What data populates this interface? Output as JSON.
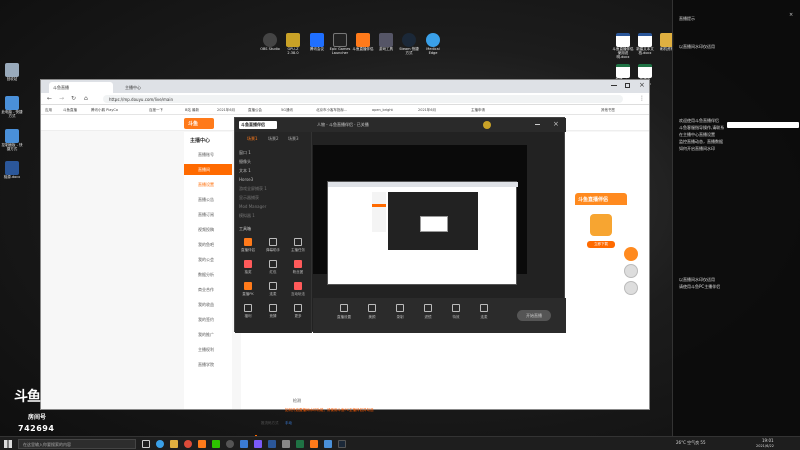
{
  "desktop": {
    "left_icons": [
      {
        "label": "回收站",
        "color": "#9ab"
      },
      {
        "label": "此电脑 - 快捷方式",
        "color": "#4a90d9"
      },
      {
        "label": "控制面板 - 快捷方式",
        "color": "#4a90d9"
      },
      {
        "label": "桃源.docx",
        "color": "#2b579a"
      }
    ],
    "top_icons": [
      {
        "label": "OBS Studio",
        "color": "#444"
      },
      {
        "label": "GPU-Z 2.38.0",
        "color": "#c9a227"
      },
      {
        "label": "腾讯会议",
        "color": "#1f6fff"
      },
      {
        "label": "Epic Games Launcher",
        "color": "#222"
      },
      {
        "label": "斗鱼直播伴侣",
        "color": "#ff7a1a"
      },
      {
        "label": "游戏工具",
        "color": "#556"
      },
      {
        "label": "Steam 快捷方式",
        "color": "#1b2838"
      },
      {
        "label": "Medical Edge",
        "color": "#3aa0e8"
      }
    ],
    "right_icons": [
      {
        "label": "斗鱼直播伴侣使用说明.docx",
        "color": "#2b579a"
      },
      {
        "label": "新建文本文档.docx",
        "color": "#2b579a"
      },
      {
        "label": "刷机资料",
        "color": "#e0b040"
      },
      {
        "label": "新建.xlsx",
        "color": "#1f7244"
      },
      {
        "label": "新建文本.xlsx",
        "color": "#1f7244"
      }
    ]
  },
  "browser": {
    "tabs": [
      "斗鱼直播",
      "主播中心"
    ],
    "url": "https://mp.douyu.com/live/main",
    "bookmarks": [
      "应用",
      "斗鱼直播",
      "腾讯小鹅 PlayCo",
      "百度一下",
      "B站 最新",
      "2021年6月",
      "直播公会",
      "5G通讯",
      "北京市小客车指标...",
      "open_bright",
      "2021年6月",
      "主播申请",
      "其他书签"
    ],
    "logo": "斗鱼",
    "sidebar": [
      {
        "label": "主播中心",
        "type": "head"
      },
      {
        "label": "直播账号",
        "type": "item"
      },
      {
        "label": "直播间",
        "type": "active"
      },
      {
        "label": "直播设置",
        "type": "sub"
      },
      {
        "label": "直播公告",
        "type": "item"
      },
      {
        "label": "直播订阅",
        "type": "item"
      },
      {
        "label": "视频投稿",
        "type": "item"
      },
      {
        "label": "我的鱼吧",
        "type": "item"
      },
      {
        "label": "我的公会",
        "type": "item"
      },
      {
        "label": "数据分析",
        "type": "item"
      },
      {
        "label": "商业合作",
        "type": "item"
      },
      {
        "label": "我的收益",
        "type": "item"
      },
      {
        "label": "我的签约",
        "type": "item"
      },
      {
        "label": "我的推广",
        "type": "item"
      },
      {
        "label": "主播权利",
        "type": "item"
      },
      {
        "label": "直播学院",
        "type": "item"
      }
    ],
    "content_lines": [
      "检测",
      "如何开启直播间水印功能，请使用斗鱼PC主播伴侣并勾选",
      "推流码方式",
      "手动"
    ],
    "section_other": "其他"
  },
  "app": {
    "title": "斗鱼直播伴侣",
    "room": "人物 - 斗鱼直播伴侣 · 已关播",
    "tabs": [
      "场景1",
      "场景2",
      "场景3"
    ],
    "sources": [
      "窗口 1",
      "摄像头",
      "文本 1",
      "Horse3",
      "游戏全屏捕获 1",
      "显示器捕获",
      "Mod Manager",
      "模拟器 1"
    ],
    "tools_label": "工具箱",
    "tools": [
      "直播伴侣",
      "弹幕助手",
      "主播任务",
      "抽奖",
      "红包",
      "粉丝团",
      "直播PK",
      "连麦",
      "互动玩法",
      "福利",
      "竞猜",
      "更多"
    ],
    "bottom": [
      "直播设置",
      "美颜",
      "录制",
      "滤镜",
      "特效",
      "连麦"
    ],
    "start_label": "开始直播"
  },
  "panel": {
    "lines_top": [
      "直播提示",
      "以直播间水印仅适用"
    ],
    "lines_mid": [
      "欢迎使用斗鱼直播伴侣",
      "斗鱼客服指导操作,请联系",
      "在主播中心直播设置",
      "监控直播动态，直播数据",
      "如何开启直播间水印"
    ],
    "lines_bottom": [
      "以直播间水印仅适用",
      "请使用斗鱼PC主播伴侣"
    ]
  },
  "taskbar": {
    "search_placeholder": "在这里输入你要搜索的内容",
    "weather": "26°C 空气良 55",
    "time": "19:01",
    "date": "2021/6/22"
  },
  "room_logo": {
    "big": "斗鱼",
    "mid": "房间号",
    "number": "742694"
  },
  "ad": {
    "title": "斗鱼直播伴侣",
    "button": "立即下载"
  }
}
